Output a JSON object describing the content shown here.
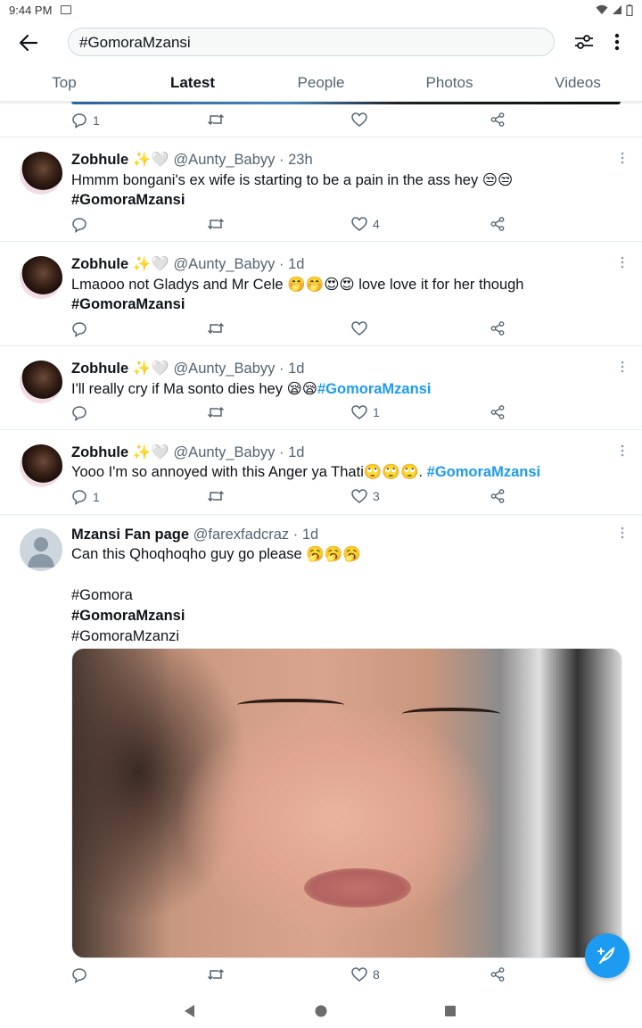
{
  "status_bar": {
    "time": "9:44 PM"
  },
  "search": {
    "query": "#GomoraMzansi"
  },
  "tabs": [
    {
      "label": "Top",
      "active": false
    },
    {
      "label": "Latest",
      "active": true
    },
    {
      "label": "People",
      "active": false
    },
    {
      "label": "Photos",
      "active": false
    },
    {
      "label": "Videos",
      "active": false
    }
  ],
  "top_actions": {
    "reply_count": "1",
    "retweet_count": "",
    "like_count": ""
  },
  "tweets": [
    {
      "name": "Zobhule",
      "name_emoji": "✨🤍",
      "handle": "@Aunty_Babyy",
      "time": "· 23h",
      "text": "Hmmm bongani's ex wife is starting to be a pain in the ass hey 😒😒",
      "hashtag": "#GomoraMzansi",
      "reply_count": "",
      "retweet_count": "",
      "like_count": "4"
    },
    {
      "name": "Zobhule",
      "name_emoji": "✨🤍",
      "handle": "@Aunty_Babyy",
      "time": "· 1d",
      "text": "Lmaooo not Gladys and Mr Cele 🤭🤭😍😍 love love it for her though",
      "hashtag": "#GomoraMzansi",
      "reply_count": "",
      "retweet_count": "",
      "like_count": ""
    },
    {
      "name": "Zobhule",
      "name_emoji": "✨🤍",
      "handle": "@Aunty_Babyy",
      "time": "· 1d",
      "text": "I'll really cry if Ma sonto dies hey 😪😪",
      "hashtag": "#GomoraMzansi",
      "reply_count": "",
      "retweet_count": "",
      "like_count": "1"
    },
    {
      "name": "Zobhule",
      "name_emoji": "✨🤍",
      "handle": "@Aunty_Babyy",
      "time": "· 1d",
      "text": "Yooo I'm so annoyed with this Anger ya Thati🙄🙄🙄. ",
      "hashtag": "#GomoraMzansi",
      "reply_count": "1",
      "retweet_count": "",
      "like_count": "3"
    },
    {
      "name": "Mzansi Fan page",
      "name_emoji": "",
      "handle": "@farexfadcraz",
      "time": "· 1d",
      "text": "Can this Qhoqhoqho guy go please 🥱🥱🥱",
      "hashtags": [
        "#Gomora",
        "#GomoraMzansi",
        "#GomoraMzanzi"
      ],
      "reply_count": "",
      "retweet_count": "",
      "like_count": "8"
    }
  ],
  "colors": {
    "accent": "#1d9bf0",
    "text": "#0f1419",
    "secondary": "#536471",
    "divider": "#e6ecf0"
  }
}
